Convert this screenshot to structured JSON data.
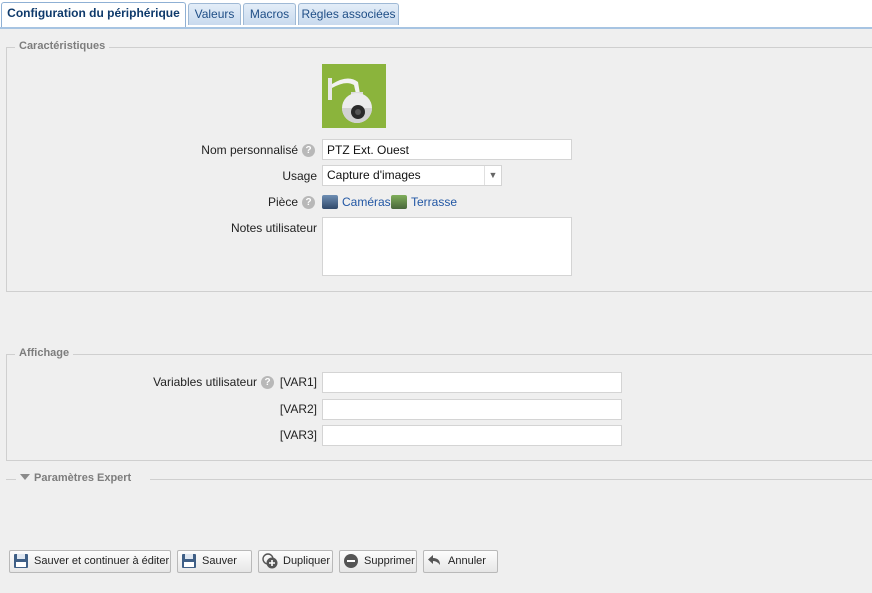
{
  "tabs": [
    {
      "label": "Configuration du périphérique",
      "active": true
    },
    {
      "label": "Valeurs"
    },
    {
      "label": "Macros"
    },
    {
      "label": "Règles associées"
    }
  ],
  "characteristics": {
    "legend": "Caractéristiques",
    "name_label": "Nom personnalisé",
    "name_value": "PTZ Ext. Ouest",
    "usage_label": "Usage",
    "usage_value": "Capture d'images",
    "room_label": "Pièce",
    "rooms": [
      "Caméras",
      "Terrasse"
    ],
    "notes_label": "Notes utilisateur",
    "notes_value": ""
  },
  "display": {
    "legend": "Affichage",
    "vars_label": "Variables utilisateur",
    "vars": [
      {
        "label": "[VAR1]",
        "value": ""
      },
      {
        "label": "[VAR2]",
        "value": ""
      },
      {
        "label": "[VAR3]",
        "value": ""
      }
    ]
  },
  "expert": {
    "label": "Paramètres Expert"
  },
  "buttons": {
    "save_continue": "Sauver et continuer à éditer",
    "save": "Sauver",
    "duplicate": "Dupliquer",
    "delete": "Supprimer",
    "cancel": "Annuler"
  },
  "help_glyph": "?",
  "colors": {
    "accent": "#1f4e86",
    "link": "#2257a4",
    "device_bg": "#8bb43c"
  }
}
